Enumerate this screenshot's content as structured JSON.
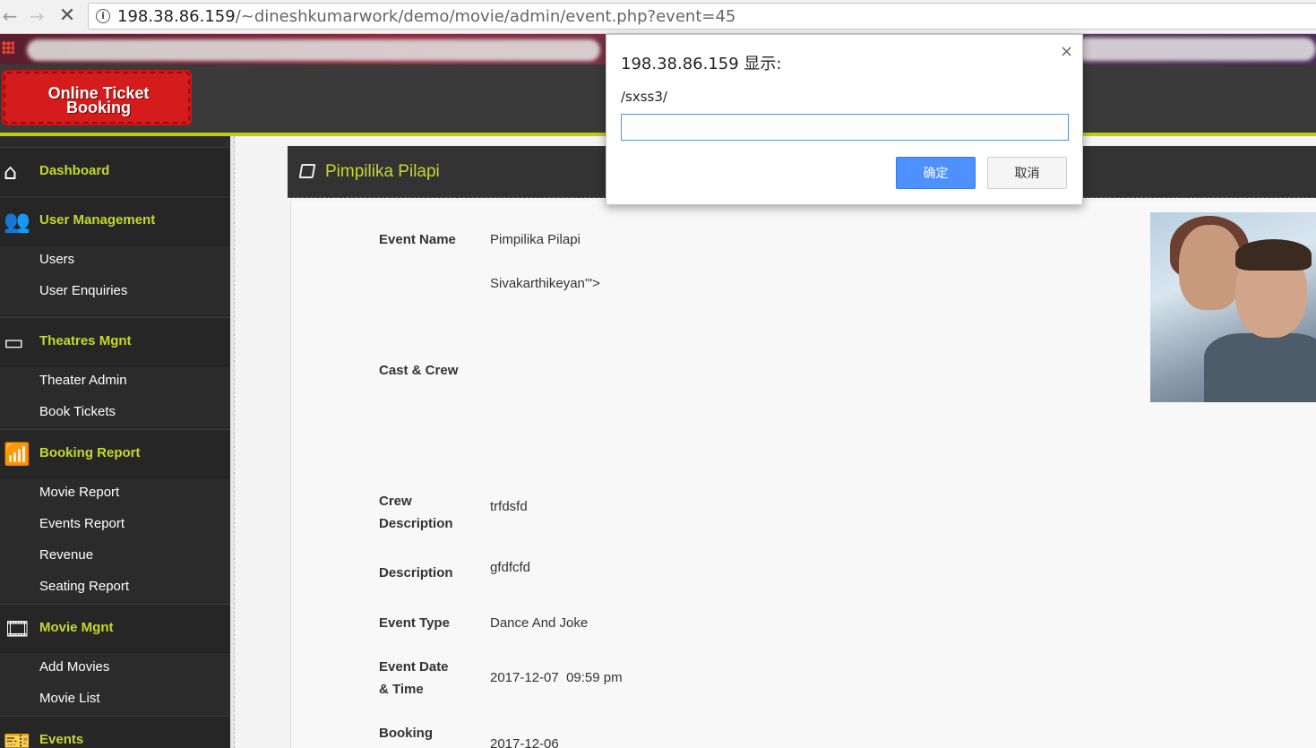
{
  "browser": {
    "url_host": "198.38.86.159",
    "url_path": "/~dineshkumarwork/demo/movie/admin/event.php?event=45"
  },
  "site": {
    "logo_line1": "Online Ticket",
    "logo_line2": "Booking"
  },
  "sidebar": {
    "sections": [
      {
        "label": "Dashboard",
        "icon": "home-icon",
        "items": []
      },
      {
        "label": "User Management",
        "icon": "users-icon",
        "items": [
          "Users",
          "User Enquiries"
        ]
      },
      {
        "label": "Theatres Mgnt",
        "icon": "monitor-icon",
        "items": [
          "Theater Admin",
          "Book Tickets"
        ]
      },
      {
        "label": "Booking Report",
        "icon": "chart-icon",
        "items": [
          "Movie Report",
          "Events Report",
          "Revenue",
          "Seating Report"
        ]
      },
      {
        "label": "Movie Mgnt",
        "icon": "film-icon",
        "items": [
          "Add Movies",
          "Movie List"
        ]
      },
      {
        "label": "Events",
        "icon": "ticket-icon",
        "items": []
      }
    ]
  },
  "panel": {
    "title": "Pimpilika Pilapi",
    "fields": {
      "event_name_label": "Event Name",
      "event_name_value": "Pimpilika Pilapi",
      "cast_value": "Sivakarthikeyan'\">",
      "cast_label": "Cast & Crew",
      "crew_desc_label_1": "Crew",
      "crew_desc_label_2": "Description",
      "crew_desc_value": "trfdsfd",
      "desc_label": "Description",
      "desc_value": "gfdfcfd",
      "type_label": "Event Type",
      "type_value": "Dance And Joke",
      "date_label_1": "Event Date",
      "date_label_2": "& Time",
      "date_value": "2017-12-07  09:59 pm",
      "booking_label": "Booking",
      "booking_value": "2017-12-06"
    }
  },
  "dialog": {
    "title": "198.38.86.159 显示:",
    "message": "/sxss3/",
    "input_value": "",
    "ok_label": "确定",
    "cancel_label": "取消",
    "close_glyph": "×"
  },
  "colors": {
    "accent_lime": "#c4d92b",
    "sidebar_bg": "#2b2b2b",
    "logo_red": "#d41c1c",
    "dialog_ok": "#4d90fe"
  }
}
